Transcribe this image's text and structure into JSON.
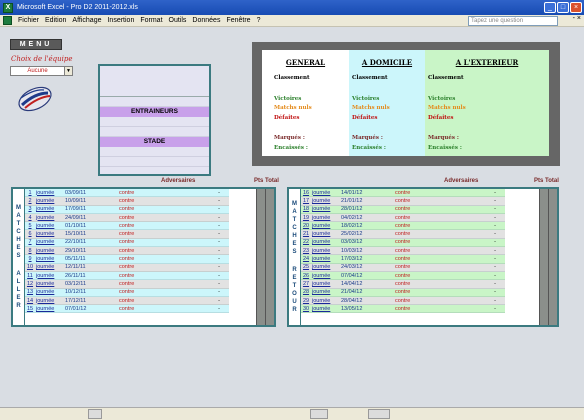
{
  "window": {
    "title": "Microsoft Excel - Pro D2  2011-2012.xls",
    "app_letter": "X"
  },
  "menu": {
    "items": [
      {
        "label": "Fichier",
        "ul": "F"
      },
      {
        "label": "Edition",
        "ul": "E"
      },
      {
        "label": "Affichage",
        "ul": "A"
      },
      {
        "label": "Insertion",
        "ul": "I"
      },
      {
        "label": "Format",
        "ul": "m"
      },
      {
        "label": "Outils",
        "ul": "O"
      },
      {
        "label": "Données",
        "ul": "D"
      },
      {
        "label": "Fenêtre",
        "ul": "n"
      },
      {
        "label": "?",
        "ul": ""
      }
    ],
    "help_placeholder": "Tapez une question",
    "right_glyph": "- ×"
  },
  "sheet": {
    "menu_button": "MENU",
    "choix_label": "Choix de l'équipe",
    "team_selected": "Aucune",
    "panel": {
      "entraineurs": "ENTRAINEURS",
      "stade": "STADE"
    },
    "stats": {
      "columns": [
        {
          "title": "GENERAL",
          "bg": "#ffffff"
        },
        {
          "title": "A DOMICILE",
          "bg": "#ccf6fb"
        },
        {
          "title": "A L'EXTERIEUR",
          "bg": "#c9f5c7"
        }
      ],
      "lines": {
        "classement": "Classement",
        "victoires": "Victoires",
        "nuls": "Matchs nuls",
        "defaites": "Défaites",
        "marques": "Marqués :",
        "encaisses": "Encaissés :"
      }
    },
    "aller": {
      "side_top": [
        "M",
        "A",
        "T",
        "C",
        "H",
        "E",
        "S"
      ],
      "side_bottom": [
        "A",
        "L",
        "L",
        "E",
        "R"
      ],
      "header_adversaires": "Adversaires",
      "header_pts": "Pts",
      "header_total": "Total",
      "rows": [
        {
          "n": "1",
          "sup": "e",
          "j": "journée",
          "d": "03/09/11",
          "c": "contre",
          "dash": "-"
        },
        {
          "n": "2",
          "j": "journée",
          "d": "10/09/11",
          "c": "contre",
          "dash": "-"
        },
        {
          "n": "3",
          "j": "journée",
          "d": "17/09/11",
          "c": "contre",
          "dash": "-"
        },
        {
          "n": "4",
          "j": "journée",
          "d": "24/09/11",
          "c": "contre",
          "dash": "-"
        },
        {
          "n": "5",
          "j": "journée",
          "d": "01/10/11",
          "c": "contre",
          "dash": "-"
        },
        {
          "n": "6",
          "j": "journée",
          "d": "15/10/11",
          "c": "contre",
          "dash": "-"
        },
        {
          "n": "7",
          "j": "journée",
          "d": "22/10/11",
          "c": "contre",
          "dash": "-"
        },
        {
          "n": "8",
          "j": "journée",
          "d": "29/10/11",
          "c": "contre",
          "dash": "-"
        },
        {
          "n": "9",
          "j": "journée",
          "d": "05/11/11",
          "c": "contre",
          "dash": "-"
        },
        {
          "n": "10",
          "j": "journée",
          "d": "12/11/11",
          "c": "contre",
          "dash": "-"
        },
        {
          "n": "11",
          "j": "journée",
          "d": "26/11/11",
          "c": "contre",
          "dash": "-"
        },
        {
          "n": "12",
          "j": "journée",
          "d": "03/12/11",
          "c": "contre",
          "dash": "-"
        },
        {
          "n": "13",
          "j": "journée",
          "d": "10/12/11",
          "c": "contre",
          "dash": "-"
        },
        {
          "n": "14",
          "j": "journée",
          "d": "17/12/11",
          "c": "contre",
          "dash": "-"
        },
        {
          "n": "15",
          "j": "journée",
          "d": "07/01/12",
          "c": "contre",
          "dash": "-"
        }
      ]
    },
    "retour": {
      "side_top": [
        "M",
        "A",
        "T",
        "C",
        "H",
        "E",
        "S"
      ],
      "side_bottom": [
        "R",
        "E",
        "T",
        "O",
        "U",
        "R"
      ],
      "header_adversaires": "Adversaires",
      "header_pts": "Pts",
      "header_total": "Total",
      "rows": [
        {
          "n": "16",
          "j": "journée",
          "d": "14/01/12",
          "c": "contre",
          "dash": "-"
        },
        {
          "n": "17",
          "j": "journée",
          "d": "21/01/12",
          "c": "contre",
          "dash": "-"
        },
        {
          "n": "18",
          "j": "journée",
          "d": "28/01/12",
          "c": "contre",
          "dash": "-"
        },
        {
          "n": "19",
          "j": "journée",
          "d": "04/02/12",
          "c": "contre",
          "dash": "-"
        },
        {
          "n": "20",
          "j": "journée",
          "d": "18/02/12",
          "c": "contre",
          "dash": "-"
        },
        {
          "n": "21",
          "j": "journée",
          "d": "25/02/12",
          "c": "contre",
          "dash": "-"
        },
        {
          "n": "22",
          "j": "journée",
          "d": "03/03/12",
          "c": "contre",
          "dash": "-"
        },
        {
          "n": "23",
          "j": "journée",
          "d": "10/03/12",
          "c": "contre",
          "dash": "-"
        },
        {
          "n": "24",
          "j": "journée",
          "d": "17/03/12",
          "c": "contre",
          "dash": "-"
        },
        {
          "n": "25",
          "j": "journée",
          "d": "24/03/12",
          "c": "contre",
          "dash": "-"
        },
        {
          "n": "26",
          "j": "journée",
          "d": "07/04/12",
          "c": "contre",
          "dash": "-"
        },
        {
          "n": "27",
          "j": "journée",
          "d": "14/04/12",
          "c": "contre",
          "dash": "-"
        },
        {
          "n": "28",
          "j": "journée",
          "d": "21/04/12",
          "c": "contre",
          "dash": "-"
        },
        {
          "n": "29",
          "j": "journée",
          "d": "28/04/12",
          "c": "contre",
          "dash": "-"
        },
        {
          "n": "30",
          "j": "journée",
          "d": "13/05/12",
          "c": "contre",
          "dash": "-"
        }
      ]
    },
    "colors": {
      "aller_even": "#ccf6fb",
      "aller_odd": "#e2e2e2",
      "retour_even": "#c9f5c7",
      "retour_odd": "#e2e2e2",
      "contre": "#c02020"
    }
  }
}
